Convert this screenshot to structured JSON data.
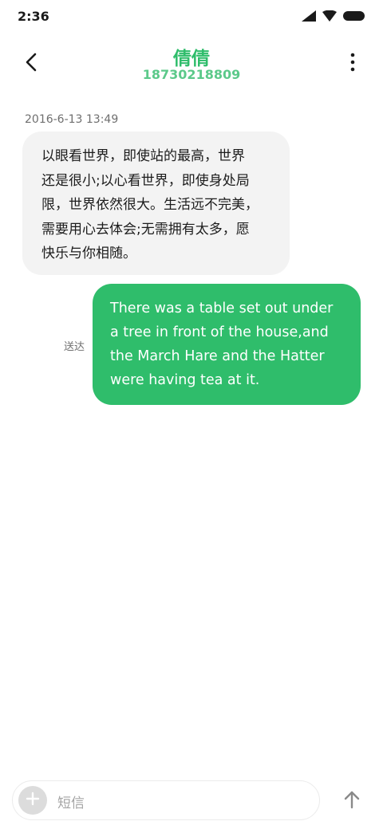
{
  "status_bar": {
    "time": "2:36",
    "icons": [
      "signal-icon",
      "wifi-icon",
      "battery-icon"
    ]
  },
  "header": {
    "contact_name": "倩倩",
    "contact_number": "18730218809",
    "back_icon": "chevron-left-icon",
    "more_icon": "more-vertical-icon"
  },
  "conversation": {
    "timestamp": "2016-6-13 13:49",
    "incoming_message": {
      "lines": [
        "以眼看世界，即使站的最高，世界",
        "还是很小;以心看世界，即使身处局",
        "限，世界依然很大。生活远不完美，",
        "需要用心去体会;无需拥有太多，愿",
        "快乐与你相随。"
      ]
    },
    "outgoing_message": {
      "lines": [
        "There was a table set out under",
        "a tree in front of the house,and",
        "the March Hare and the Hatter",
        "were having tea at it."
      ],
      "status": "送达"
    }
  },
  "compose": {
    "placeholder": "短信",
    "add_icon": "plus-icon",
    "send_icon": "arrow-up-icon"
  },
  "colors": {
    "accent": "#2fbd6b",
    "incoming_bubble": "#f3f3f3",
    "outgoing_text": "#ffffff"
  }
}
